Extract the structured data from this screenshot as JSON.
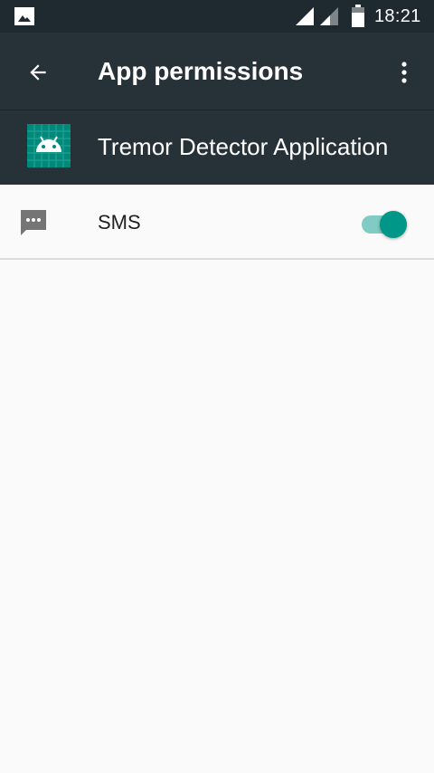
{
  "status_bar": {
    "time": "18:21",
    "icons": [
      "gallery-icon",
      "signal-icon",
      "signal-icon",
      "battery-icon"
    ]
  },
  "toolbar": {
    "title": "App permissions",
    "back_icon": "arrow-back-icon",
    "overflow_icon": "more-vert-icon"
  },
  "app": {
    "name": "Tremor Detector Application",
    "icon": "android-icon",
    "icon_color": "#00897b"
  },
  "permissions": [
    {
      "label": "SMS",
      "icon": "sms-icon",
      "enabled": true
    }
  ],
  "colors": {
    "status_bar": "#1f2a30",
    "toolbar": "#263238",
    "background": "#fafafa",
    "accent": "#009688",
    "accent_track": "#80cbc4"
  }
}
